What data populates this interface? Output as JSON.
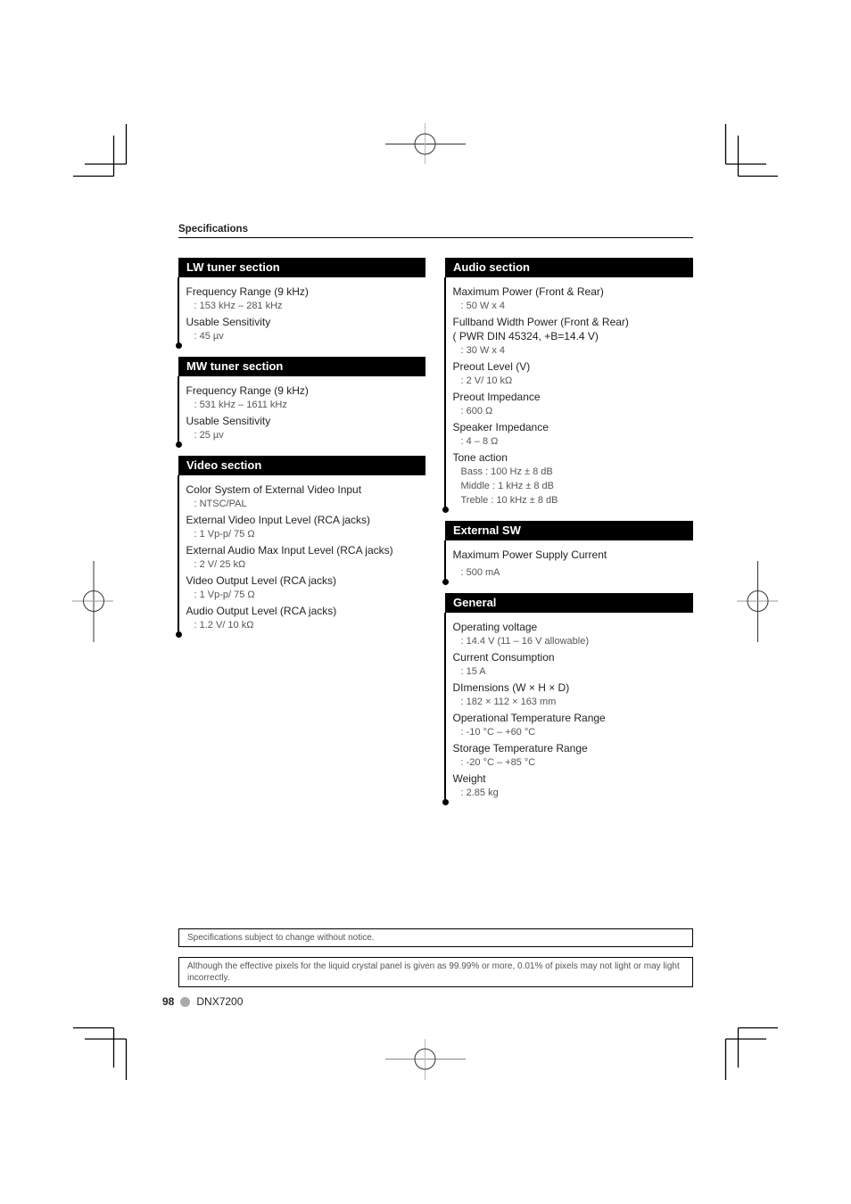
{
  "page": {
    "running_head": "Specifications",
    "page_number": "98",
    "model": "DNX7200"
  },
  "columns": {
    "left": [
      {
        "title": "LW tuner section",
        "items": [
          {
            "labels": [
              "Frequency Range (9 kHz)"
            ],
            "values": [
              ": 153 kHz – 281 kHz"
            ]
          },
          {
            "labels": [
              "Usable Sensitivity"
            ],
            "values": [
              ": 45 µv"
            ]
          }
        ]
      },
      {
        "title": "MW tuner section",
        "items": [
          {
            "labels": [
              "Frequency Range (9 kHz)"
            ],
            "values": [
              ": 531 kHz – 1611 kHz"
            ]
          },
          {
            "labels": [
              "Usable Sensitivity"
            ],
            "values": [
              ": 25 µv"
            ]
          }
        ]
      },
      {
        "title": "Video section",
        "items": [
          {
            "labels": [
              "Color System of External Video Input"
            ],
            "values": [
              ": NTSC/PAL"
            ]
          },
          {
            "labels": [
              "External Video Input Level (RCA jacks)"
            ],
            "values": [
              ": 1 Vp-p/ 75 Ω"
            ]
          },
          {
            "labels": [
              "External Audio Max Input Level (RCA jacks)"
            ],
            "values": [
              ": 2 V/ 25 kΩ"
            ]
          },
          {
            "labels": [
              "Video Output Level (RCA jacks)"
            ],
            "values": [
              ": 1 Vp-p/ 75 Ω"
            ]
          },
          {
            "labels": [
              "Audio Output Level (RCA jacks)"
            ],
            "values": [
              ": 1.2 V/ 10 kΩ"
            ]
          }
        ]
      }
    ],
    "right": [
      {
        "title": "Audio section",
        "items": [
          {
            "labels": [
              "Maximum Power (Front & Rear)"
            ],
            "values": [
              ": 50 W x 4"
            ]
          },
          {
            "labels": [
              "Fullband Width Power (Front & Rear)",
              "( PWR DIN 45324, +B=14.4 V)"
            ],
            "values": [
              ": 30 W x 4"
            ]
          },
          {
            "labels": [
              "Preout Level (V)"
            ],
            "values": [
              ": 2 V/ 10 kΩ"
            ]
          },
          {
            "labels": [
              "Preout Impedance"
            ],
            "values": [
              ": 600 Ω"
            ]
          },
          {
            "labels": [
              "Speaker Impedance"
            ],
            "values": [
              ": 4 – 8 Ω"
            ]
          },
          {
            "labels": [
              "Tone action"
            ],
            "values": [
              "Bass : 100 Hz ± 8 dB",
              "Middle : 1 kHz ± 8 dB",
              "Treble : 10 kHz ± 8 dB"
            ]
          }
        ]
      },
      {
        "title": "External SW",
        "items": [
          {
            "labels": [
              "Maximum Power Supply Current"
            ],
            "values": [
              ": 500 mA"
            ]
          }
        ]
      },
      {
        "title": "General",
        "items": [
          {
            "labels": [
              "Operating voltage"
            ],
            "values": [
              ": 14.4 V (11 – 16 V allowable)"
            ]
          },
          {
            "labels": [
              "Current Consumption"
            ],
            "values": [
              ": 15 A"
            ]
          },
          {
            "labels": [
              "DImensions  (W × H × D)"
            ],
            "values": [
              ": 182 × 112 × 163 mm"
            ]
          },
          {
            "labels": [
              "Operational Temperature Range"
            ],
            "values": [
              ": -10 °C – +60 °C"
            ]
          },
          {
            "labels": [
              "Storage Temperature Range"
            ],
            "values": [
              ": -20 °C – +85 °C"
            ]
          },
          {
            "labels": [
              "Weight"
            ],
            "values": [
              ": 2.85 kg"
            ]
          }
        ]
      }
    ]
  },
  "notices": [
    "Specifications subject to change without notice.",
    "Although the effective pixels for the liquid crystal panel is given as 99.99% or more, 0.01% of pixels may not light or may light incorrectly."
  ]
}
